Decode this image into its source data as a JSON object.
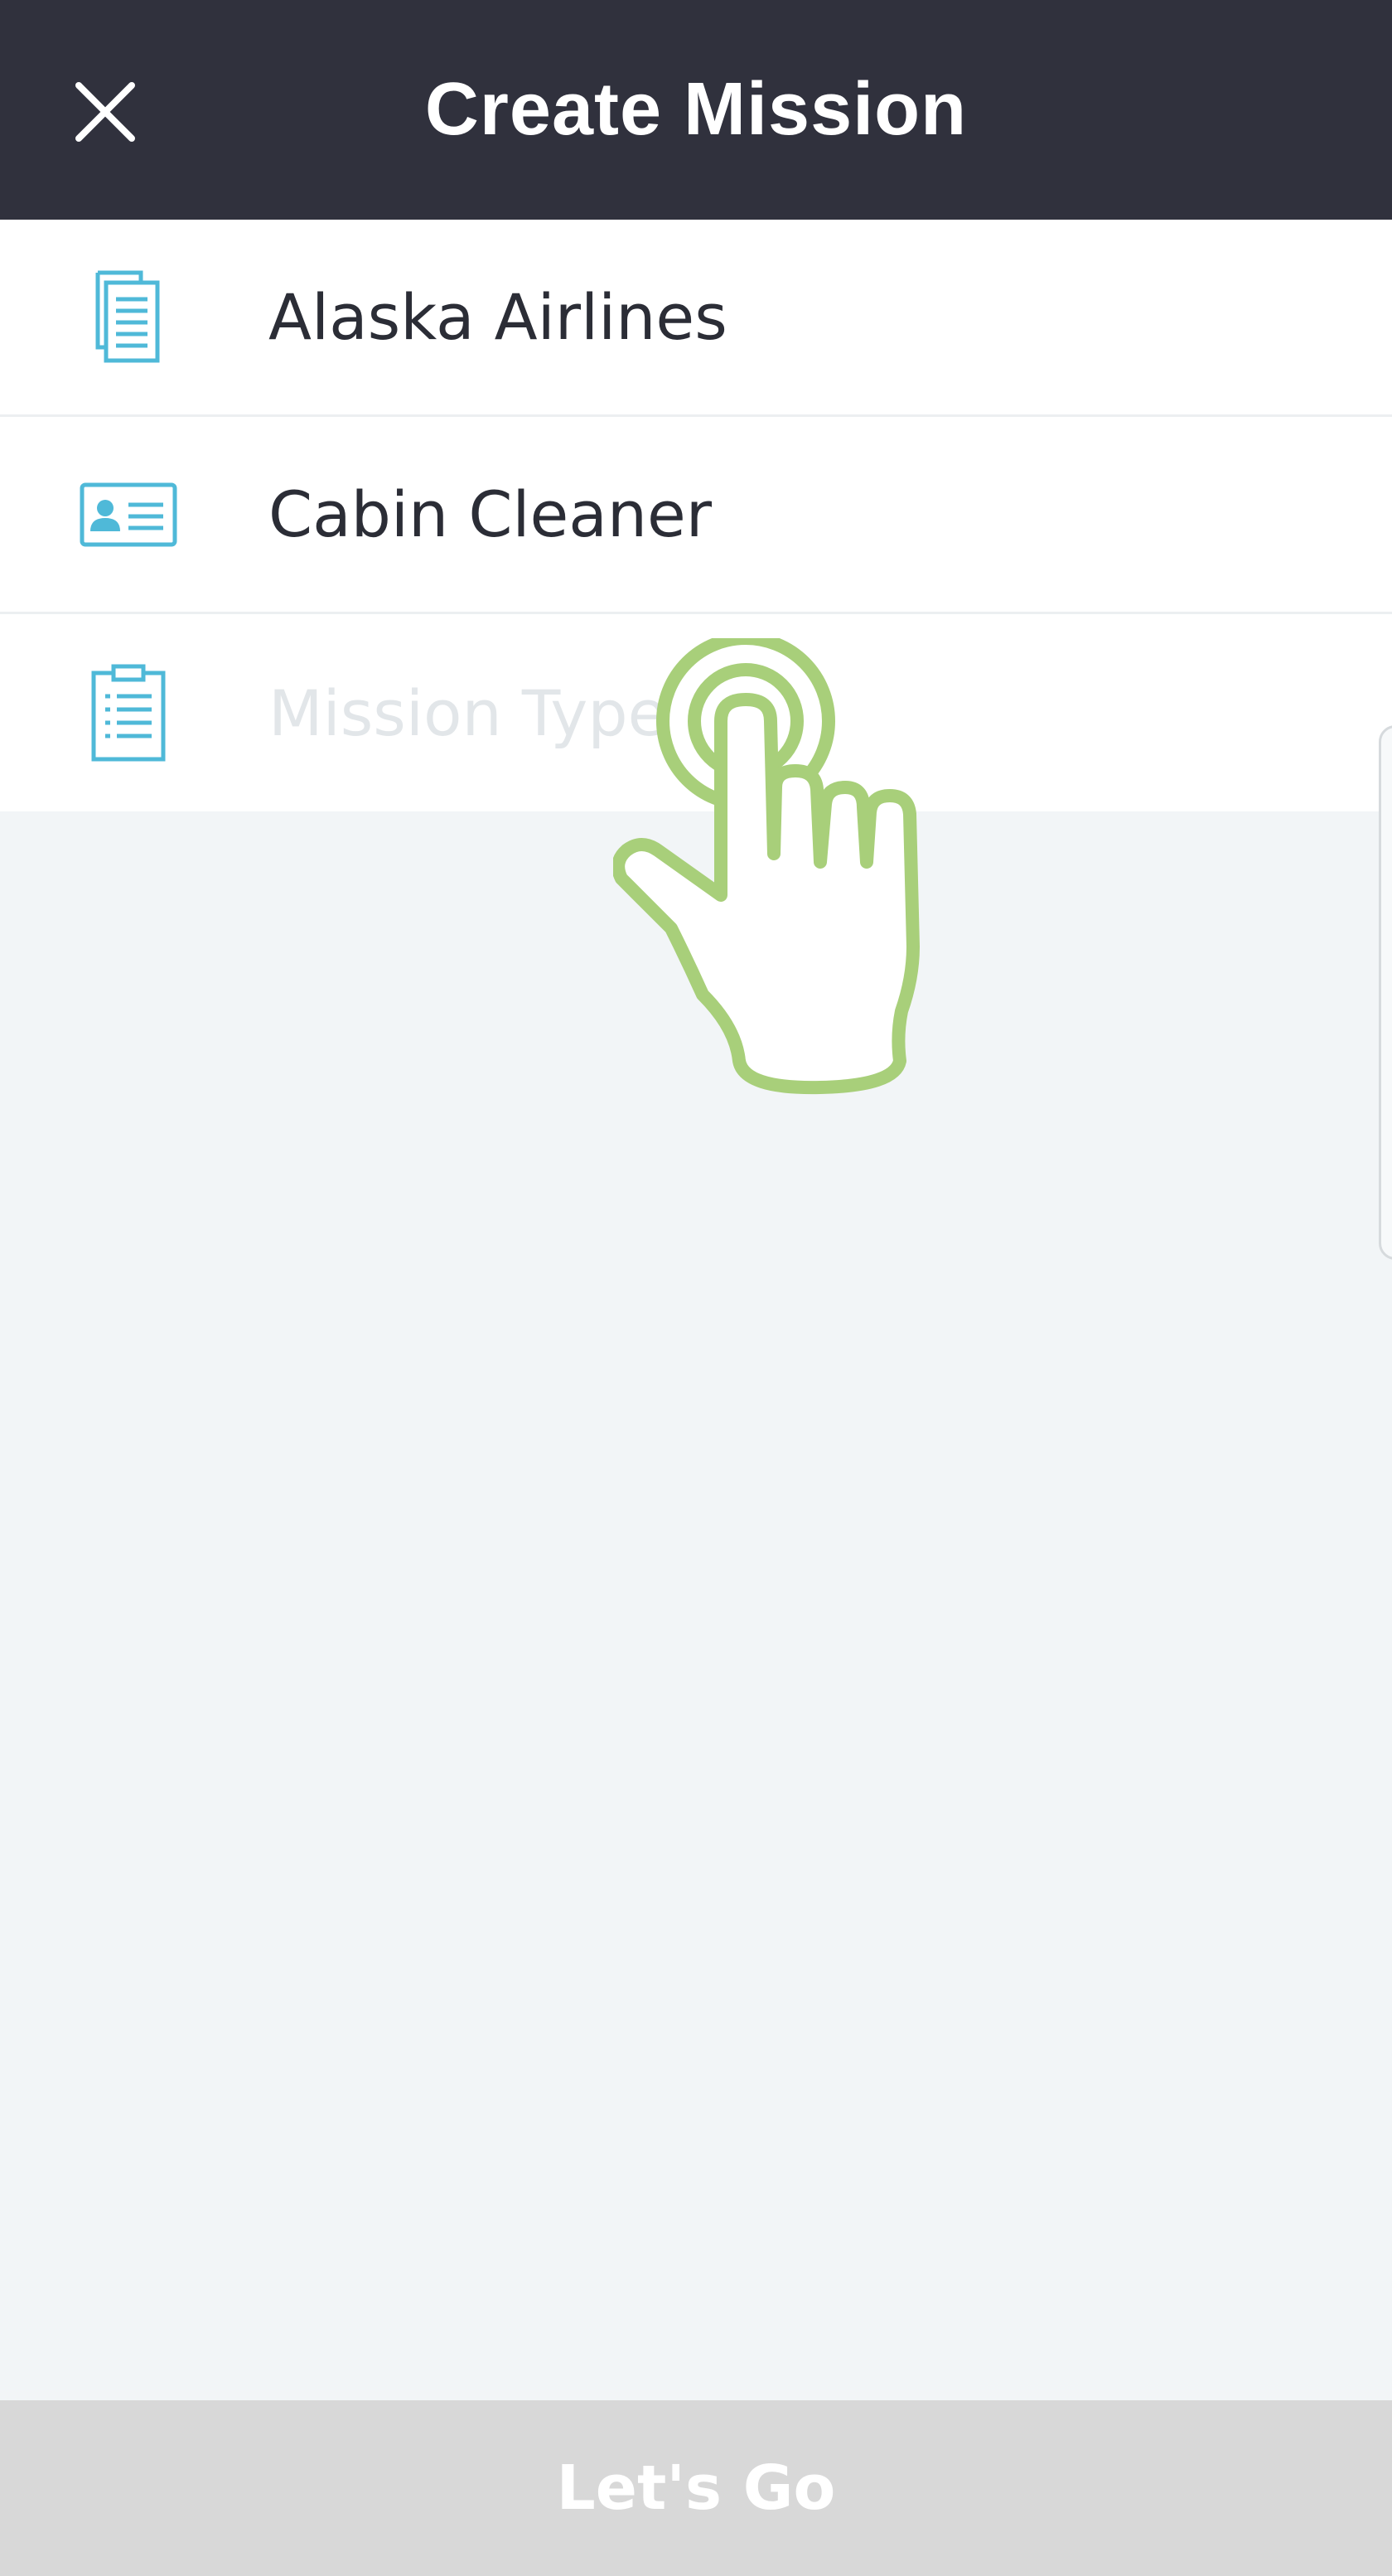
{
  "header": {
    "title": "Create Mission",
    "close_icon": "close-icon"
  },
  "form": {
    "rows": [
      {
        "value": "Alaska Airlines",
        "icon": "documents-icon"
      },
      {
        "value": "Cabin Cleaner",
        "icon": "id-card-icon"
      },
      {
        "placeholder": "Mission Type",
        "icon": "clipboard-icon"
      }
    ]
  },
  "overlay": {
    "icon": "tap-gesture-hand-icon"
  },
  "footer": {
    "button_label": "Let's Go"
  },
  "colors": {
    "header_bg": "#30313d",
    "icon_accent": "#4fb9d8",
    "hand_accent": "#a8cf7a",
    "footer_bg": "#d8d8d8",
    "background": "#f2f5f7"
  }
}
